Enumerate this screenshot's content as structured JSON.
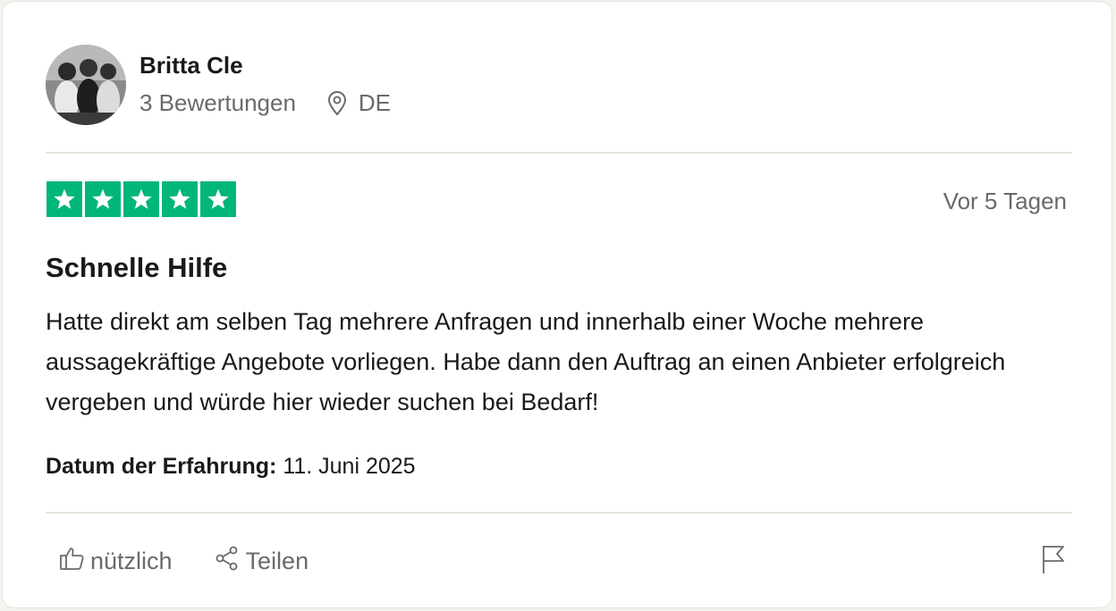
{
  "reviewer": {
    "name": "Britta Cle",
    "review_count": "3 Bewertungen",
    "location": "DE",
    "avatar_icon": "avatar-photo"
  },
  "review": {
    "rating": 5,
    "rating_max": 5,
    "star_color": "#00b67a",
    "relative_date": "Vor 5 Tagen",
    "title": "Schnelle Hilfe",
    "text": "Hatte direkt am selben Tag mehrere Anfragen und innerhalb einer Woche mehrere aussagekräftige Angebote vorliegen. Habe dann den Auftrag an einen Anbieter erfolgreich vergeben und würde hier wieder suchen bei Bedarf!",
    "experience_label": "Datum der Erfahrung:",
    "experience_date": "11. Juni 2025"
  },
  "actions": {
    "useful_label": "nützlich",
    "useful_icon": "thumbs-up-icon",
    "share_label": "Teilen",
    "share_icon": "share-icon",
    "report_icon": "flag-icon"
  }
}
